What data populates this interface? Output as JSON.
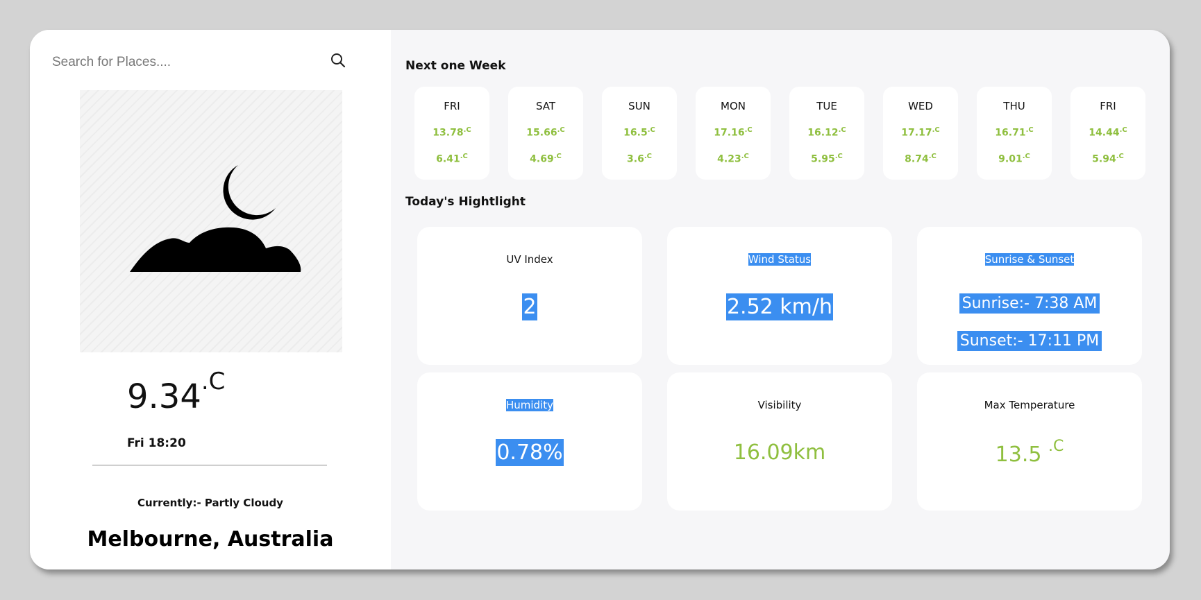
{
  "search": {
    "placeholder": "Search for Places...."
  },
  "current": {
    "temp": "9.34",
    "unit": ".C",
    "datetime": "Fri 18:20",
    "condition": "Currently:- Partly Cloudy",
    "location": "Melbourne, Australia",
    "icon": "moon-cloud-icon"
  },
  "week": {
    "title": "Next one Week",
    "days": [
      {
        "name": "FRI",
        "max": "13.78",
        "min": "6.41"
      },
      {
        "name": "SAT",
        "max": "15.66",
        "min": "4.69"
      },
      {
        "name": "SUN",
        "max": "16.5",
        "min": "3.6"
      },
      {
        "name": "MON",
        "max": "17.16",
        "min": "4.23"
      },
      {
        "name": "TUE",
        "max": "16.12",
        "min": "5.95"
      },
      {
        "name": "WED",
        "max": "17.17",
        "min": "8.74"
      },
      {
        "name": "THU",
        "max": "16.71",
        "min": "9.01"
      },
      {
        "name": "FRI",
        "max": "14.44",
        "min": "5.94"
      }
    ],
    "unit": ".C"
  },
  "highlights": {
    "title": "Today's Hightlight",
    "uv": {
      "label": "UV Index",
      "value": "2"
    },
    "wind": {
      "label": "Wind Status",
      "value": "2.52 km/h"
    },
    "sun": {
      "label": "Sunrise & Sunset",
      "sunrise": "Sunrise:- 7:38 AM",
      "sunset": "Sunset:- 17:11 PM"
    },
    "humidity": {
      "label": "Humidity",
      "value": "0.78%"
    },
    "visibility": {
      "label": "Visibility",
      "value": "16.09km"
    },
    "maxtemp": {
      "label": "Max Temperature",
      "value": "13.5 ",
      "unit": ".C"
    }
  },
  "colors": {
    "accent_green": "#8fbf3f",
    "selection_blue": "#3b8ef0"
  }
}
